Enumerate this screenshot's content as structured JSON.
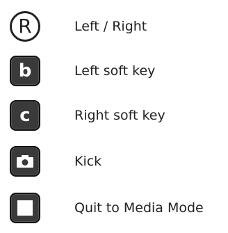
{
  "controls": [
    {
      "key_glyph": "R",
      "icon": "r-circle-icon",
      "label": "Left / Right"
    },
    {
      "key_glyph": "b",
      "icon": "b-key-icon",
      "label": "Left soft key"
    },
    {
      "key_glyph": "c",
      "icon": "c-key-icon",
      "label": "Right soft key"
    },
    {
      "key_glyph": "",
      "icon": "camera-key-icon",
      "label": "Kick"
    },
    {
      "key_glyph": "",
      "icon": "square-key-icon",
      "label": "Quit to Media Mode"
    }
  ]
}
